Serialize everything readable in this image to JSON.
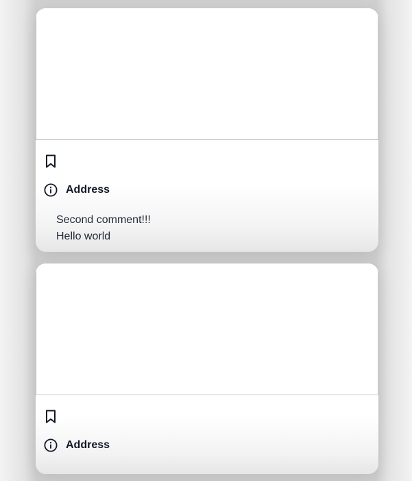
{
  "posts": [
    {
      "address_label": "Address",
      "comments": [
        "Second comment!!!",
        "Hello world"
      ]
    },
    {
      "address_label": "Address",
      "comments": []
    }
  ],
  "icons": {
    "save": "bookmark-icon",
    "info": "info-circle-icon"
  }
}
